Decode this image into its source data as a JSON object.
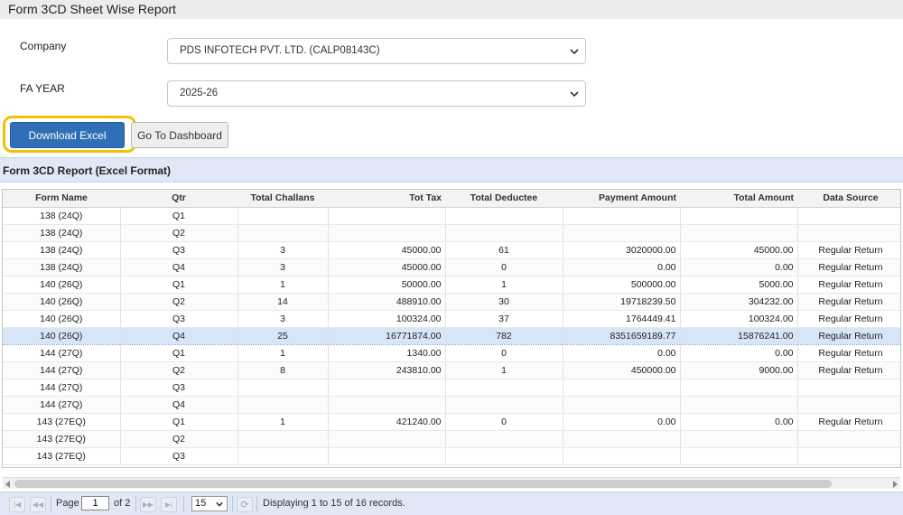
{
  "header": {
    "title": "Form 3CD Sheet Wise Report"
  },
  "form": {
    "company_label": "Company",
    "company_value": "PDS INFOTECH PVT. LTD. (CALP08143C)",
    "year_label": "FA YEAR",
    "year_value": "2025-26"
  },
  "buttons": {
    "download_label": "Download Excel",
    "dashboard_label": "Go To Dashboard"
  },
  "grid": {
    "caption": "Form 3CD Report (Excel Format)",
    "columns": [
      "Form Name",
      "Qtr",
      "Total Challans",
      "Tot Tax",
      "Total Deductee",
      "Payment Amount",
      "Total Amount",
      "Data Source"
    ],
    "rows": [
      [
        "138 (24Q)",
        "Q1",
        "",
        "",
        "",
        "",
        "",
        ""
      ],
      [
        "138 (24Q)",
        "Q2",
        "",
        "",
        "",
        "",
        "",
        ""
      ],
      [
        "138 (24Q)",
        "Q3",
        "3",
        "45000.00",
        "61",
        "3020000.00",
        "45000.00",
        "Regular Return"
      ],
      [
        "138 (24Q)",
        "Q4",
        "3",
        "45000.00",
        "0",
        "0.00",
        "0.00",
        "Regular Return"
      ],
      [
        "140 (26Q)",
        "Q1",
        "1",
        "50000.00",
        "1",
        "500000.00",
        "5000.00",
        "Regular Return"
      ],
      [
        "140 (26Q)",
        "Q2",
        "14",
        "488910.00",
        "30",
        "19718239.50",
        "304232.00",
        "Regular Return"
      ],
      [
        "140 (26Q)",
        "Q3",
        "3",
        "100324.00",
        "37",
        "1764449.41",
        "100324.00",
        "Regular Return"
      ],
      [
        "140 (26Q)",
        "Q4",
        "25",
        "16771874.00",
        "782",
        "8351659189.77",
        "15876241.00",
        "Regular Return"
      ],
      [
        "144 (27Q)",
        "Q1",
        "1",
        "1340.00",
        "0",
        "0.00",
        "0.00",
        "Regular Return"
      ],
      [
        "144 (27Q)",
        "Q2",
        "8",
        "243810.00",
        "1",
        "450000.00",
        "9000.00",
        "Regular Return"
      ],
      [
        "144 (27Q)",
        "Q3",
        "",
        "",
        "",
        "",
        "",
        ""
      ],
      [
        "144 (27Q)",
        "Q4",
        "",
        "",
        "",
        "",
        "",
        ""
      ],
      [
        "143 (27EQ)",
        "Q1",
        "1",
        "421240.00",
        "0",
        "0.00",
        "0.00",
        "Regular Return"
      ],
      [
        "143 (27EQ)",
        "Q2",
        "",
        "",
        "",
        "",
        "",
        ""
      ],
      [
        "143 (27EQ)",
        "Q3",
        "",
        "",
        "",
        "",
        "",
        ""
      ]
    ],
    "selected_row": 7
  },
  "pager": {
    "page_label": "Page",
    "page_value": "1",
    "of_label": "of 2",
    "page_size": "15",
    "status": "Displaying 1 to 15 of 16 records."
  },
  "colors": {
    "accent": "#2f6fb5",
    "highlight_ring": "#f2c200",
    "selected_row": "#d6e5f7",
    "panel_bg": "#dfe8f4"
  },
  "icons": [
    "chevron-down-icon",
    "first-page-icon",
    "prev-page-icon",
    "next-page-icon",
    "last-page-icon",
    "refresh-icon"
  ]
}
